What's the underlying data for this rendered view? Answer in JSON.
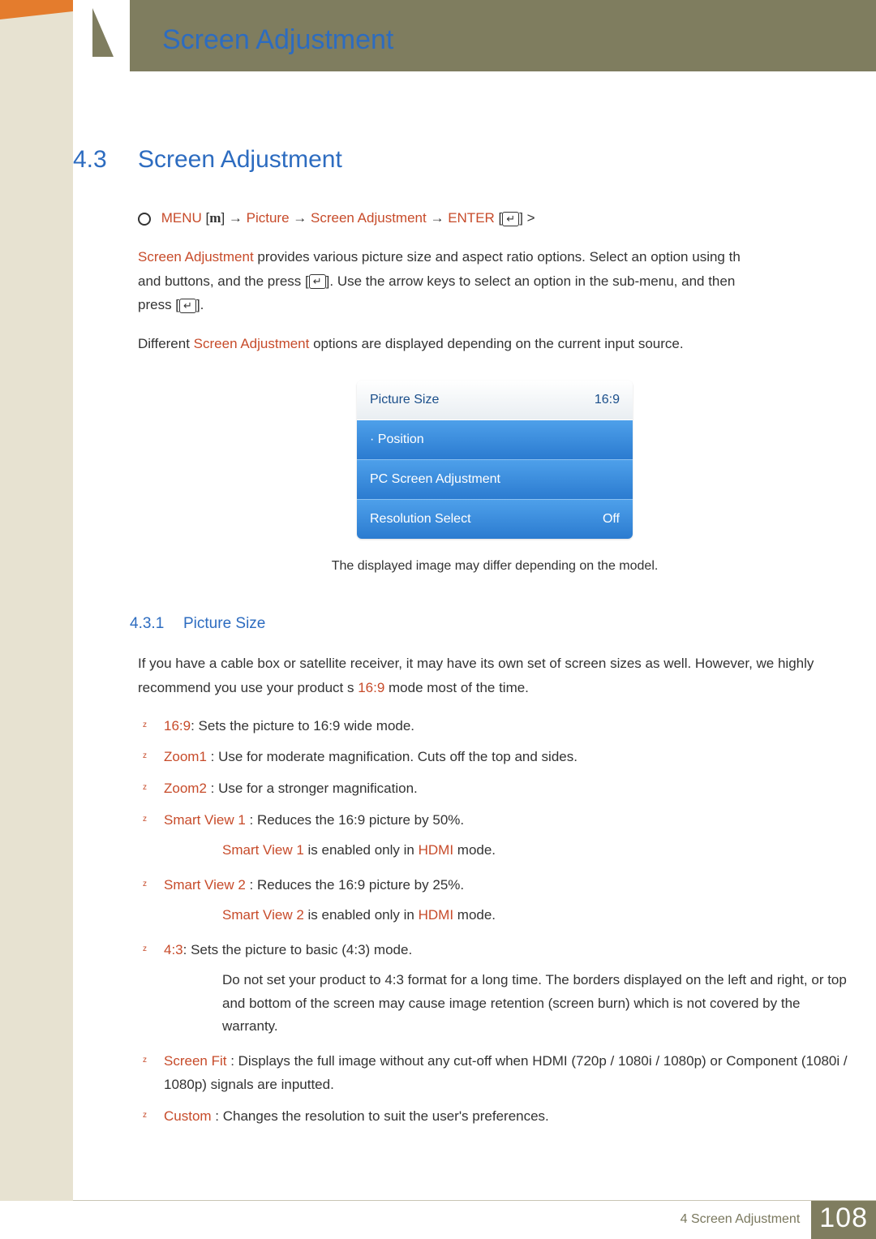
{
  "header": {
    "title": "Screen Adjustment"
  },
  "section": {
    "number": "4.3",
    "title": "Screen Adjustment"
  },
  "nav": {
    "menu_label": "MENU",
    "m_glyph": "m",
    "arrow": "→",
    "picture": "Picture",
    "screen_adj": "Screen Adjustment",
    "enter_label": "ENTER",
    "gt": ">"
  },
  "paragraphs": {
    "p1_a": "Screen Adjustment",
    "p1_b": " provides various picture size and aspect ratio options. Select an option using th",
    "p2_a": "and       buttons, and the press [",
    "p2_b": "]. Use the arrow keys to select an option in the sub-menu, and then",
    "p3_a": "press [",
    "p3_b": "].",
    "p4_a": "Different ",
    "p4_b": "Screen Adjustment",
    "p4_c": " options are displayed depending on the current input source."
  },
  "menu_box": {
    "rows": [
      {
        "label": "Picture Size",
        "value": "16:9",
        "style": "sel"
      },
      {
        "label": "· Position",
        "value": "",
        "style": "blue"
      },
      {
        "label": "PC Screen Adjustment",
        "value": "",
        "style": "blue"
      },
      {
        "label": "Resolution Select",
        "value": "Off",
        "style": "blue"
      }
    ],
    "caption": "The displayed image may differ depending on the model."
  },
  "subsection": {
    "number": "4.3.1",
    "title": "Picture Size"
  },
  "subpara": {
    "a": "If you have a cable box or satellite receiver, it may have its own set of screen sizes as well. However, we highly recommend you use your product s ",
    "b": "16:9",
    "c": " mode most of the time."
  },
  "bullets": {
    "b1_a": "16:9",
    "b1_b": ": Sets the picture to 16:9 wide mode.",
    "b2_a": "Zoom1",
    "b2_b": " : Use for moderate magnification. Cuts off the top and sides.",
    "b3_a": "Zoom2",
    "b3_b": " : Use for a stronger magnification.",
    "b4_a": "Smart View 1",
    "b4_b": " : Reduces the 16:9 picture by 50%.",
    "n4_a": "Smart View 1",
    "n4_b": " is enabled only in ",
    "n4_c": "HDMI",
    "n4_d": " mode.",
    "b5_a": "Smart View 2",
    "b5_b": " : Reduces the 16:9 picture by 25%.",
    "n5_a": "Smart View 2",
    "n5_b": " is enabled only in ",
    "n5_c": "HDMI",
    "n5_d": " mode.",
    "b6_a": "4:3",
    "b6_b": ": Sets the picture to basic (4:3) mode.",
    "n6": "Do not set your product to 4:3 format for a long time. The borders displayed on the left and right, or top and bottom of the screen may cause image retention (screen burn) which is not covered by the warranty.",
    "b7_a": "Screen Fit",
    "b7_b": " : Displays the full image without any cut-off when HDMI (720p / 1080i / 1080p) or Component (1080i / 1080p) signals are inputted.",
    "b8_a": "Custom",
    "b8_b": " : Changes the resolution to suit the user's preferences."
  },
  "footer": {
    "chapter_ref": "4 Screen Adjustment",
    "page_number": "108"
  }
}
